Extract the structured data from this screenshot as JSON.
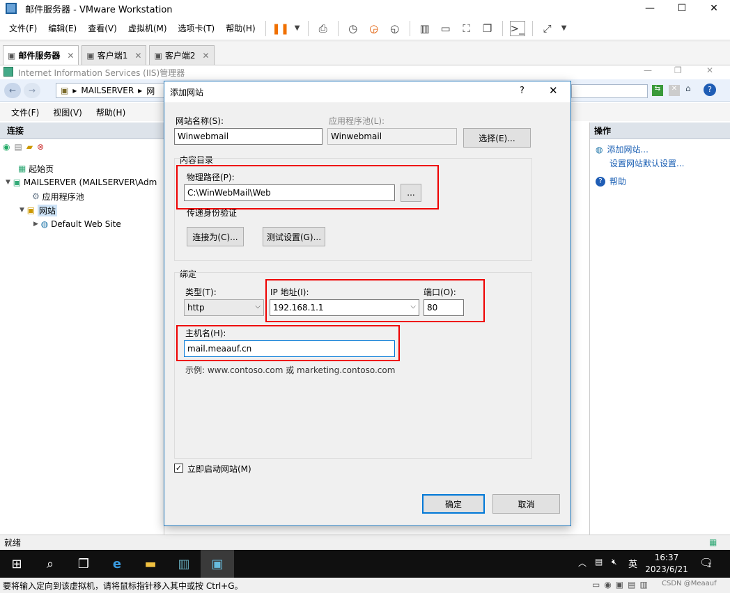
{
  "vmware": {
    "title": "邮件服务器 - VMware Workstation",
    "menu": [
      "文件(F)",
      "编辑(E)",
      "查看(V)",
      "虚拟机(M)",
      "选项卡(T)",
      "帮助(H)"
    ],
    "tabs": [
      "邮件服务器",
      "客户端1",
      "客户端2"
    ],
    "status_hint": "要将输入定向到该虚拟机，请将鼠标指针移入其中或按 Ctrl+G。",
    "watermark": "CSDN @Meaauf"
  },
  "iis": {
    "title": "Internet Information Services (IIS)管理器",
    "address": [
      "MAILSERVER",
      "网"
    ],
    "menu": [
      "文件(F)",
      "视图(V)",
      "帮助(H)"
    ],
    "left_header": "连接",
    "tree": [
      "起始页",
      "MAILSERVER (MAILSERVER\\Adm",
      "应用程序池",
      "网站",
      "Default Web Site"
    ],
    "right_header": "操作",
    "actions": [
      "添加网站...",
      "设置网站默认设置...",
      "帮助"
    ],
    "status": "就绪"
  },
  "dialog": {
    "title": "添加网站",
    "help": "?",
    "site_name_label": "网站名称(S):",
    "site_name_value": "Winwebmail",
    "app_pool_label": "应用程序池(L):",
    "app_pool_value": "Winwebmail",
    "select_button": "选择(E)...",
    "content_dir_label": "内容目录",
    "physical_path_label": "物理路径(P):",
    "physical_path_value": "C:\\WinWebMail\\Web",
    "browse_button": "...",
    "pass_auth_label": "传递身份验证",
    "connect_as_button": "连接为(C)...",
    "test_settings_button": "测试设置(G)...",
    "binding_label": "绑定",
    "type_label": "类型(T):",
    "type_value": "http",
    "ip_label": "IP 地址(I):",
    "ip_value": "192.168.1.1",
    "port_label": "端口(O):",
    "port_value": "80",
    "host_label": "主机名(H):",
    "host_value": "mail.meaauf.cn",
    "example": "示例: www.contoso.com 或 marketing.contoso.com",
    "start_now_label": "立即启动网站(M)",
    "start_now_checked": true,
    "ok_button": "确定",
    "cancel_button": "取消"
  },
  "taskbar": {
    "ime": "英",
    "time": "16:37",
    "date": "2023/6/21",
    "notif_count": "1"
  }
}
